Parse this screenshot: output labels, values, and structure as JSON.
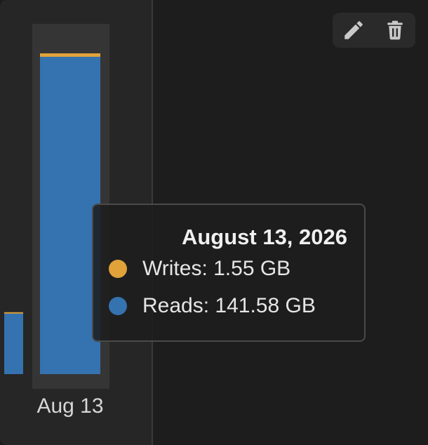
{
  "chart_data": {
    "type": "bar",
    "stacked": true,
    "categories": [
      "Aug 13"
    ],
    "series": [
      {
        "name": "Reads",
        "color": "#3572b0",
        "values": [
          141.58
        ],
        "unit": "GB"
      },
      {
        "name": "Writes",
        "color": "#e0a33a",
        "values": [
          1.55
        ],
        "unit": "GB"
      }
    ],
    "partial_previous_bar": {
      "reads": 27.0,
      "writes": 0.4,
      "note_visible": false
    },
    "ylim": [
      0,
      160
    ],
    "grid": false,
    "legend": "none"
  },
  "tooltip": {
    "title": "August 13, 2026",
    "rows": [
      {
        "label": "Writes",
        "sep": ": ",
        "value": "1.55 GB",
        "color": "#e0a33a"
      },
      {
        "label": "Reads",
        "sep": ": ",
        "value": "141.58 GB",
        "color": "#3572b0"
      }
    ]
  },
  "toolbar": {
    "edit_icon": "pencil-icon",
    "delete_icon": "trash-icon"
  }
}
